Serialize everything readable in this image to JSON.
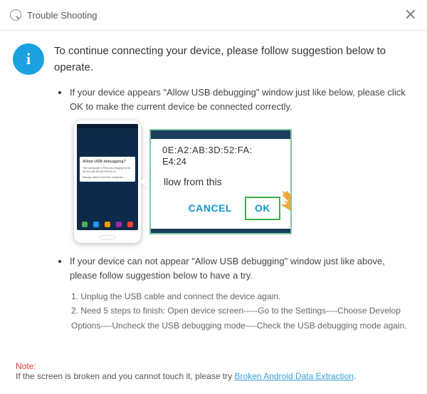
{
  "titlebar": {
    "title": "Trouble Shooting"
  },
  "info_icon_char": "i",
  "heading": "To continue connecting your device, please follow suggestion below to operate.",
  "bullet1": "If your device appears \"Allow USB debugging\" window just like below, please click OK to make the current device  be connected correctly.",
  "phone": {
    "dialog_title": "Allow USB debugging?",
    "dialog_body": "The computer's RSA key fingerprint is:",
    "dialog_fp": "0E:A2:AB:3D:52:FA:E4:24",
    "dialog_check": "Always allow from this computer"
  },
  "zoom": {
    "fp_line1": "0E:A2:AB:3D:52:FA:",
    "fp_line2": "E4:24",
    "allow_text": "llow from this",
    "cancel": "CANCEL",
    "ok": "OK"
  },
  "bullet2": "If your device can not appear \"Allow USB debugging\" window just like above, please follow suggestion below to have a try.",
  "step1": "1. Unplug the USB cable and connect the device again.",
  "step2": "2. Need 5 steps to finish: Open device screen-----Go to the Settings----Choose Develop Options----Uncheck the USB debugging mode----Check the USB debugging mode again.",
  "note": {
    "label": "Note:",
    "text": "If the screen is broken and you cannot touch it, please try ",
    "link": "Broken Android Data Extraction",
    "end": "."
  }
}
